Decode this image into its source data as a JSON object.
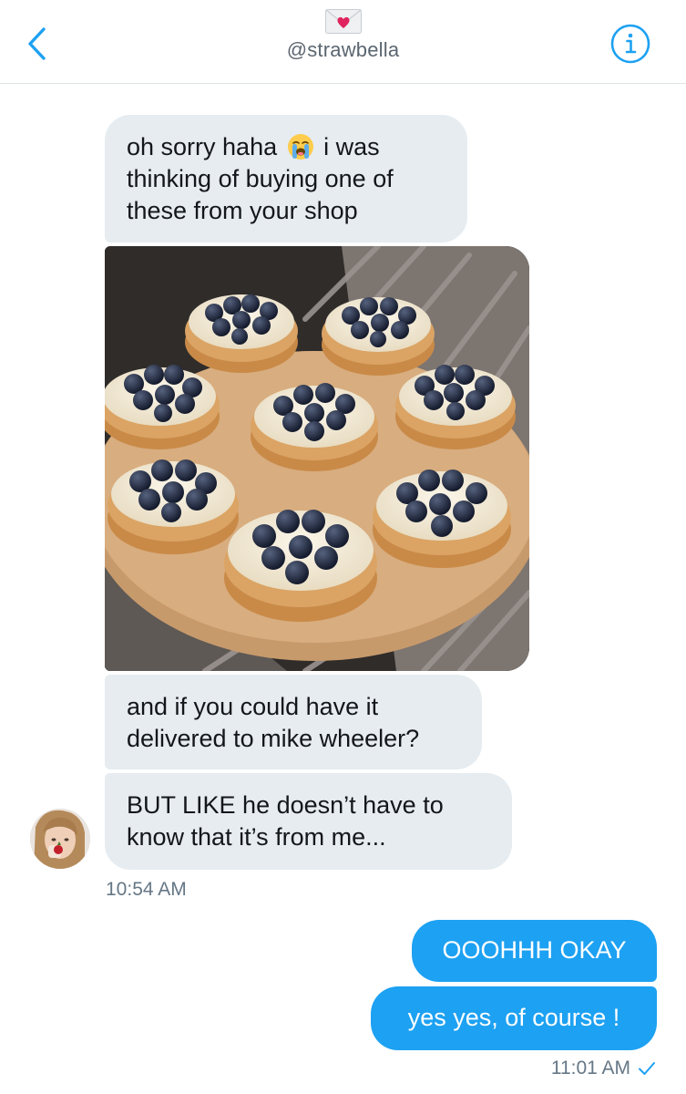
{
  "header": {
    "handle": "@strawbella",
    "back_icon": "chevron-left-icon",
    "info_icon": "info-icon",
    "envelope_icon": "love-letter-icon"
  },
  "messages": [
    {
      "direction": "incoming",
      "text_before_emoji": "oh sorry haha",
      "emoji": "loudly-crying-face",
      "text_after_emoji": "i was thinking of buying one of these from your shop"
    },
    {
      "direction": "incoming",
      "type": "image",
      "description_icon": "blueberry-cakes-photo"
    },
    {
      "direction": "incoming",
      "text": "and if you could have it delivered to mike wheeler?"
    },
    {
      "direction": "incoming",
      "text": "BUT LIKE he doesn’t have to know that it’s from me..."
    },
    {
      "direction": "outgoing",
      "text": "OOOHHH OKAY"
    },
    {
      "direction": "outgoing",
      "text": "yes yes, of course !"
    }
  ],
  "timestamps": {
    "incoming": "10:54 AM",
    "outgoing": "11:01 AM",
    "outgoing_status_icon": "checkmark-icon"
  },
  "colors": {
    "accent": "#1da1f2",
    "incoming_bubble": "#e6ecf0",
    "timestamp": "#657786"
  }
}
